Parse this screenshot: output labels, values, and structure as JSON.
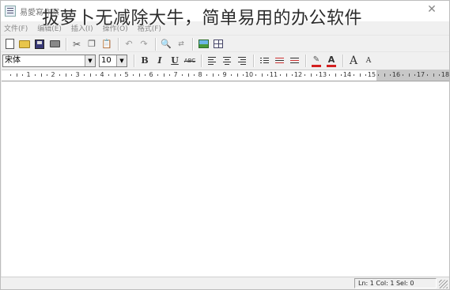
{
  "window": {
    "title": "易愛寫作家",
    "close_glyph": "✕"
  },
  "overlay_caption": "拔萝卜无减除大牛，简单易用的办公软件",
  "menu": {
    "items": [
      "文件(F)",
      "编辑(E)",
      "插入(I)",
      "操作(O)",
      "格式(F)"
    ]
  },
  "toolbar_format": {
    "font_name": "宋体",
    "font_size": "10",
    "bold_label": "B",
    "italic_label": "I",
    "underline_label": "U",
    "strike_label": "ABC",
    "grow_font_label": "A",
    "shrink_font_label": "A"
  },
  "ruler": {
    "labels": [
      "1",
      "2",
      "3",
      "4",
      "5",
      "6",
      "7",
      "8",
      "9",
      "10",
      "11",
      "12",
      "13",
      "14",
      "15",
      "16",
      "17",
      "18"
    ]
  },
  "status": {
    "position_text": "Ln: 1 Col: 1 Sel: 0"
  },
  "colors": {
    "accent_red": "#d42020",
    "margin_gray": "#c8c8c8"
  },
  "icons": [
    "new-document-icon",
    "open-folder-icon",
    "save-icon",
    "print-icon",
    "cut-icon",
    "copy-icon",
    "paste-icon",
    "undo-icon",
    "redo-icon",
    "find-icon",
    "replace-icon",
    "insert-image-icon",
    "insert-table-icon"
  ]
}
